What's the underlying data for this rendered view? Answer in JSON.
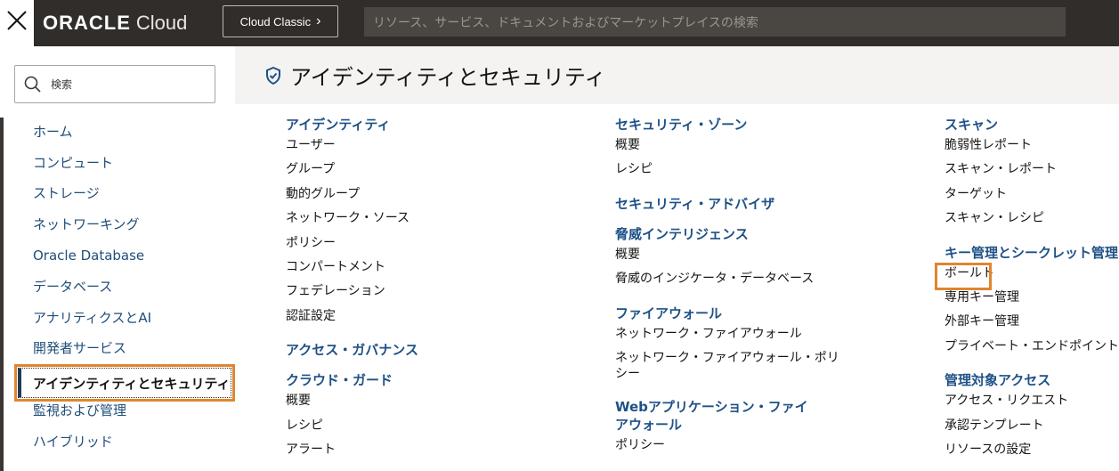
{
  "topbar": {
    "brand": "ORACLE",
    "product": "Cloud",
    "classic_button": "Cloud Classic",
    "search_placeholder": "リソース、サービス、ドキュメントおよびマーケットプレイスの検索"
  },
  "sidebar": {
    "search_label": "検索",
    "items": [
      {
        "label": "ホーム"
      },
      {
        "label": "コンピュート"
      },
      {
        "label": "ストレージ"
      },
      {
        "label": "ネットワーキング"
      },
      {
        "label": "Oracle Database"
      },
      {
        "label": "データベース"
      },
      {
        "label": "アナリティクスとAI"
      },
      {
        "label": "開発者サービス"
      },
      {
        "label": "アイデンティティとセキュリティ",
        "active": true
      },
      {
        "label": "監視および管理"
      },
      {
        "label": "ハイブリッド"
      }
    ]
  },
  "main": {
    "title": "アイデンティティとセキュリティ",
    "columns": [
      {
        "sections": [
          {
            "heading": "アイデンティティ",
            "links": [
              "ユーザー",
              "グループ",
              "動的グループ",
              "ネットワーク・ソース",
              "ポリシー",
              "コンパートメント",
              "フェデレーション",
              "認証設定"
            ]
          },
          {
            "heading": "アクセス・ガバナンス",
            "links": []
          },
          {
            "heading": "クラウド・ガード",
            "links": [
              "概要",
              "レシピ",
              "アラート"
            ]
          }
        ]
      },
      {
        "sections": [
          {
            "heading": "セキュリティ・ゾーン",
            "links": [
              "概要",
              "レシピ"
            ]
          },
          {
            "heading": "セキュリティ・アドバイザ",
            "links": []
          },
          {
            "heading": "脅威インテリジェンス",
            "links": [
              "概要",
              "脅威のインジケータ・データベース"
            ]
          },
          {
            "heading": "ファイアウォール",
            "links": [
              "ネットワーク・ファイアウォール",
              "ネットワーク・ファイアウォール・ポリシー"
            ]
          },
          {
            "heading": "Webアプリケーション・ファイアウォール",
            "links": [
              "ポリシー"
            ]
          }
        ]
      },
      {
        "sections": [
          {
            "heading": "スキャン",
            "links": [
              "脆弱性レポート",
              "スキャン・レポート",
              "ターゲット",
              "スキャン・レシピ"
            ]
          },
          {
            "heading": "キー管理とシークレット管理",
            "links": [
              "ボールト",
              "専用キー管理",
              "外部キー管理",
              "プライベート・エンドポイント"
            ]
          },
          {
            "heading": "管理対象アクセス",
            "links": [
              "アクセス・リクエスト",
              "承認テンプレート",
              "リソースの設定"
            ]
          }
        ]
      }
    ]
  },
  "colors": {
    "topbar": "#312d2a",
    "section_heading": "#1e5187",
    "highlight": "#e0852f"
  }
}
